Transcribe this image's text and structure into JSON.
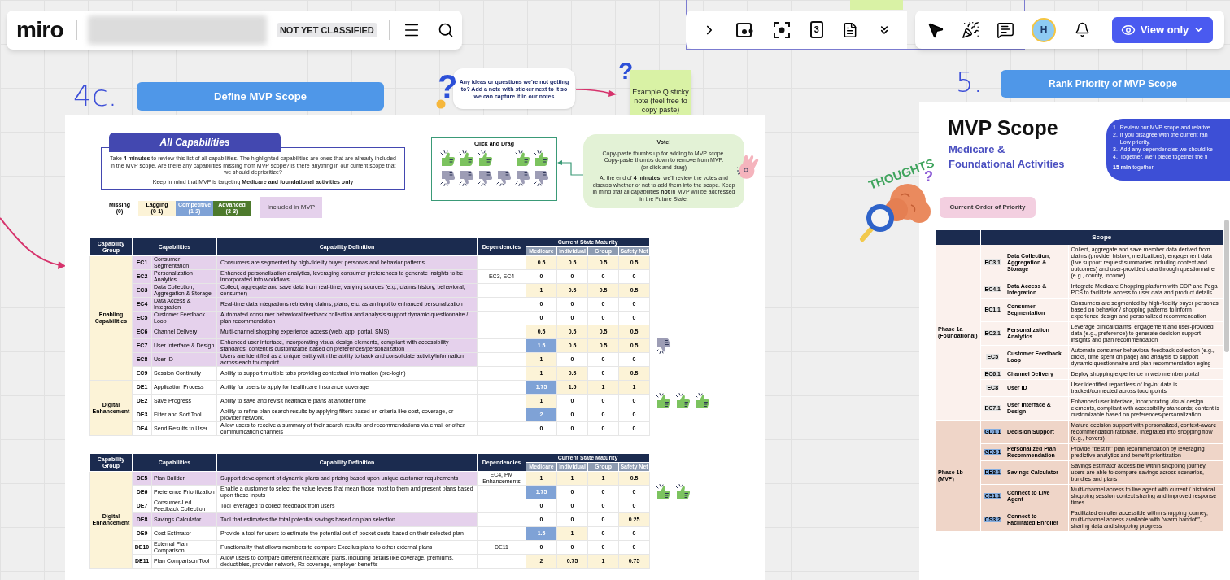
{
  "top_bar": {
    "logo": "miro",
    "classification": "NOT YET CLASSIFIED"
  },
  "board_tools": {
    "timer_card": "3"
  },
  "collab_bar": {
    "avatar": "H",
    "view_button": "View only"
  },
  "section_4c": {
    "number": "4c.",
    "title": "Define MVP Scope"
  },
  "question_note": {
    "sticker": "?",
    "text": "Any ideas or questions we're not getting to? Add a note with sticker next to it so we can capture it in our notes"
  },
  "example_note": {
    "sticker": "?",
    "text": "Example Q sticky note (feel free to copy paste)"
  },
  "section_5": {
    "number": "5.",
    "title": "Rank Priority of MVP Scope"
  },
  "thoughts_sticker": {
    "word": "THOUGHTS",
    "mark": "?"
  },
  "capabilities_frame": {
    "heading": "All Capabilities",
    "intro": "Take **4 minutes** to review this list of all capabilities. The highlighted capabilities are ones that are already included in the MVP scope. Are there any capabilities missing from MVP scope? Is there anything in our current scope that we should deprioritize?",
    "note": "Keep in mind that MVP is targeting **Medicare and foundational activities only**",
    "legend": [
      {
        "label": "Missing",
        "range": "(0)",
        "kind": "missing"
      },
      {
        "label": "Lagging",
        "range": "(0-1)",
        "kind": "lagging"
      },
      {
        "label": "Competitive",
        "range": "(1-2)",
        "kind": "competitive"
      },
      {
        "label": "Advanced",
        "range": "(2-3)",
        "kind": "advanced"
      }
    ],
    "mvp_legend": "Included in MVP",
    "drag_box": {
      "title": "Click and Drag",
      "stickers": [
        {
          "kind": "up"
        },
        {
          "kind": "up"
        },
        {
          "kind": "up"
        },
        {
          "kind": "blank"
        },
        {
          "kind": "up"
        },
        {
          "kind": "up"
        },
        {
          "kind": "down"
        },
        {
          "kind": "down"
        },
        {
          "kind": "down"
        },
        {
          "kind": "down"
        },
        {
          "kind": "down"
        },
        {
          "kind": "down"
        }
      ]
    },
    "vote_box": {
      "title": "Vote!",
      "instructions": "Copy-paste thumbs up for adding to MVP scope. Copy-paste thumbs down to remove from MVP.",
      "hint": "(or click and drag)",
      "body": "At the end of **4 minutes**, we'll review the votes and discuss whether or not to add them into the scope. Keep in mind that all capabilities **not** in MVP will be addressed in the Future State."
    },
    "tables": [
      {
        "columns": {
          "group": "Capability Group",
          "capabilities": "Capabilities",
          "definition": "Capability Definition",
          "dependencies": "Dependencies",
          "maturity_title": "Current State Maturity",
          "maturity": [
            "Medicare",
            "Individual",
            "Group",
            "Safety Net"
          ]
        },
        "groups": [
          {
            "name": "Enabling Capabilities",
            "rows": [
              {
                "code": "EC1",
                "name": "Consumer Segmentation",
                "definition": "Consumers are segmented by high-fidelity buyer personas and behavior patterns",
                "included": true,
                "maturity": [
                  {
                    "value": "0.5",
                    "kind": "lagging"
                  },
                  {
                    "value": "0.5",
                    "kind": "lagging"
                  },
                  {
                    "value": "0.5",
                    "kind": "lagging"
                  },
                  {
                    "value": "0.5",
                    "kind": "lagging"
                  }
                ]
              },
              {
                "code": "EC2",
                "name": "Personalization Analytics",
                "definition": "Enhanced personalization analytics, leveraging consumer preferences to generate insights to be incorporated into workflows",
                "dependencies": "EC3, EC4",
                "included": true,
                "maturity": [
                  {
                    "value": "0",
                    "kind": "missing"
                  },
                  {
                    "value": "0",
                    "kind": "missing"
                  },
                  {
                    "value": "0",
                    "kind": "missing"
                  },
                  {
                    "value": "0",
                    "kind": "missing"
                  }
                ]
              },
              {
                "code": "EC3",
                "name": "Data Collection, Aggregation & Storage",
                "definition": "Collect, aggregate and save data from real-time, varying sources (e.g., claims history, behavioral, consumer)",
                "included": true,
                "maturity": [
                  {
                    "value": "1",
                    "kind": "lagging"
                  },
                  {
                    "value": "0.5",
                    "kind": "lagging"
                  },
                  {
                    "value": "0.5",
                    "kind": "lagging"
                  },
                  {
                    "value": "0.5",
                    "kind": "lagging"
                  }
                ]
              },
              {
                "code": "EC4",
                "name": "Data Access & Integration",
                "definition": "Real-time data integrations retrieving claims, plans, etc. as an input to enhanced personalization",
                "included": true,
                "maturity": [
                  {
                    "value": "0",
                    "kind": "missing"
                  },
                  {
                    "value": "0",
                    "kind": "missing"
                  },
                  {
                    "value": "0",
                    "kind": "missing"
                  },
                  {
                    "value": "0",
                    "kind": "missing"
                  }
                ]
              },
              {
                "code": "EC5",
                "name": "Customer Feedback Loop",
                "definition": "Automated consumer behavioral feedback collection and analysis support dynamic questionnaire / plan recommendation",
                "included": true,
                "maturity": [
                  {
                    "value": "0",
                    "kind": "missing"
                  },
                  {
                    "value": "0",
                    "kind": "missing"
                  },
                  {
                    "value": "0",
                    "kind": "missing"
                  },
                  {
                    "value": "0",
                    "kind": "missing"
                  }
                ]
              },
              {
                "code": "EC6",
                "name": "Channel Delivery",
                "definition": "Multi-channel shopping experience access (web, app, portal, SMS)",
                "included": true,
                "maturity": [
                  {
                    "value": "0.5",
                    "kind": "lagging"
                  },
                  {
                    "value": "0.5",
                    "kind": "lagging"
                  },
                  {
                    "value": "0.5",
                    "kind": "lagging"
                  },
                  {
                    "value": "0.5",
                    "kind": "lagging"
                  }
                ]
              },
              {
                "code": "EC7",
                "name": "User Interface & Design",
                "definition": "Enhanced user interface, incorporating visual design elements, compliant with accessibility standards; content is customizable based on preferences/personalization",
                "included": true,
                "maturity": [
                  {
                    "value": "1.5",
                    "kind": "competitive"
                  },
                  {
                    "value": "0.5",
                    "kind": "lagging"
                  },
                  {
                    "value": "0.5",
                    "kind": "lagging"
                  },
                  {
                    "value": "0.5",
                    "kind": "lagging"
                  }
                ],
                "votes": [
                  {
                    "kind": "down"
                  }
                ]
              },
              {
                "code": "EC8",
                "name": "User ID",
                "definition": "Users are identified as a unique entity with the ability to track and consolidate activity/information across each touchpoint",
                "included": true,
                "maturity": [
                  {
                    "value": "1",
                    "kind": "lagging"
                  },
                  {
                    "value": "0",
                    "kind": "missing"
                  },
                  {
                    "value": "0",
                    "kind": "missing"
                  },
                  {
                    "value": "0",
                    "kind": "missing"
                  }
                ]
              },
              {
                "code": "EC9",
                "name": "Session Continuity",
                "definition": "Ability to support multiple tabs providing contextual information (pre-login)",
                "included": false,
                "maturity": [
                  {
                    "value": "1",
                    "kind": "lagging"
                  },
                  {
                    "value": "0.5",
                    "kind": "lagging"
                  },
                  {
                    "value": "0",
                    "kind": "missing"
                  },
                  {
                    "value": "0.5",
                    "kind": "lagging"
                  }
                ]
              }
            ]
          },
          {
            "name": "Digital Enhancement",
            "rows": [
              {
                "code": "DE1",
                "name": "Application Process",
                "definition": "Ability for users to apply for healthcare insurance coverage",
                "included": false,
                "maturity": [
                  {
                    "value": "1.75",
                    "kind": "competitive"
                  },
                  {
                    "value": "1.5",
                    "kind": "lagging"
                  },
                  {
                    "value": "1",
                    "kind": "lagging"
                  },
                  {
                    "value": "1",
                    "kind": "lagging"
                  }
                ]
              },
              {
                "code": "DE2",
                "name": "Save Progress",
                "definition": "Ability to save and revisit healthcare plans at another time",
                "included": false,
                "maturity": [
                  {
                    "value": "1",
                    "kind": "lagging"
                  },
                  {
                    "value": "0",
                    "kind": "missing"
                  },
                  {
                    "value": "0",
                    "kind": "missing"
                  },
                  {
                    "value": "0",
                    "kind": "missing"
                  }
                ],
                "votes": [
                  {
                    "kind": "up"
                  },
                  {
                    "kind": "up"
                  },
                  {
                    "kind": "up"
                  }
                ]
              },
              {
                "code": "DE3",
                "name": "Filter and Sort Tool",
                "definition": "Ability to refine plan search results by applying filters based on criteria like cost, coverage, or provider network.",
                "included": false,
                "maturity": [
                  {
                    "value": "2",
                    "kind": "competitive"
                  },
                  {
                    "value": "0",
                    "kind": "missing"
                  },
                  {
                    "value": "0",
                    "kind": "missing"
                  },
                  {
                    "value": "0",
                    "kind": "missing"
                  }
                ]
              },
              {
                "code": "DE4",
                "name": "Send Results to User",
                "definition": "Allow users to receive a summary of their search results and recommendations via email or other communication channels",
                "included": false,
                "maturity": [
                  {
                    "value": "0",
                    "kind": "missing"
                  },
                  {
                    "value": "0",
                    "kind": "missing"
                  },
                  {
                    "value": "0",
                    "kind": "missing"
                  },
                  {
                    "value": "0",
                    "kind": "missing"
                  }
                ]
              }
            ]
          }
        ]
      },
      {
        "columns": {
          "group": "Capability Group",
          "capabilities": "Capabilities",
          "definition": "Capability Definition",
          "dependencies": "Dependencies",
          "maturity_title": "Current State Maturity",
          "maturity": [
            "Medicare",
            "Individual",
            "Group",
            "Safety Net"
          ]
        },
        "groups": [
          {
            "name": "Digital Enhancement",
            "rows": [
              {
                "code": "DE5",
                "name": "Plan Builder",
                "definition": "Support development of dynamic plans and pricing based upon unique customer requirements",
                "dependencies": "EC4, PM Enhancements",
                "included": true,
                "maturity": [
                  {
                    "value": "1",
                    "kind": "lagging"
                  },
                  {
                    "value": "1",
                    "kind": "lagging"
                  },
                  {
                    "value": "1",
                    "kind": "lagging"
                  },
                  {
                    "value": "0.5",
                    "kind": "lagging"
                  }
                ]
              },
              {
                "code": "DE6",
                "name": "Preference Prioritization",
                "definition": "Enable a customer to select the value levers that mean those most to them and present plans based upon those inputs",
                "included": false,
                "maturity": [
                  {
                    "value": "1.75",
                    "kind": "competitive"
                  },
                  {
                    "value": "0",
                    "kind": "missing"
                  },
                  {
                    "value": "0",
                    "kind": "missing"
                  },
                  {
                    "value": "0",
                    "kind": "missing"
                  }
                ],
                "votes": [
                  {
                    "kind": "up"
                  },
                  {
                    "kind": "up"
                  }
                ]
              },
              {
                "code": "DE7",
                "name": "Consumer-Led Feedback Collection",
                "definition": "Tool leveraged to collect feedback from users",
                "included": false,
                "maturity": [
                  {
                    "value": "0",
                    "kind": "missing"
                  },
                  {
                    "value": "0",
                    "kind": "missing"
                  },
                  {
                    "value": "0",
                    "kind": "missing"
                  },
                  {
                    "value": "0",
                    "kind": "missing"
                  }
                ]
              },
              {
                "code": "DE8",
                "name": "Savings Calculator",
                "definition": "Tool that estimates the total potential savings based on plan selection",
                "included": true,
                "maturity": [
                  {
                    "value": "0",
                    "kind": "missing"
                  },
                  {
                    "value": "0",
                    "kind": "missing"
                  },
                  {
                    "value": "0",
                    "kind": "missing"
                  },
                  {
                    "value": "0.25",
                    "kind": "lagging"
                  }
                ]
              },
              {
                "code": "DE9",
                "name": "Cost Estimator",
                "definition": "Provide a tool for users to estimate the potential out-of-pocket costs based on their selected plan",
                "included": false,
                "maturity": [
                  {
                    "value": "1.5",
                    "kind": "competitive"
                  },
                  {
                    "value": "1",
                    "kind": "lagging"
                  },
                  {
                    "value": "0",
                    "kind": "missing"
                  },
                  {
                    "value": "0",
                    "kind": "missing"
                  }
                ]
              },
              {
                "code": "DE10",
                "name": "External Plan Comparison",
                "definition": "Functionality that allows members to compare Excellus plans to other external plans",
                "dependencies": "DE11",
                "included": false,
                "maturity": [
                  {
                    "value": "0",
                    "kind": "missing"
                  },
                  {
                    "value": "0",
                    "kind": "missing"
                  },
                  {
                    "value": "0",
                    "kind": "missing"
                  },
                  {
                    "value": "0",
                    "kind": "missing"
                  }
                ]
              },
              {
                "code": "DE11",
                "name": "Plan Comparison Tool",
                "definition": "Allow users to compare different healthcare plans, including details like coverage, premiums, deductibles, provider network, Rx coverage, employer benefits",
                "included": false,
                "maturity": [
                  {
                    "value": "2",
                    "kind": "lagging"
                  },
                  {
                    "value": "0.75",
                    "kind": "lagging"
                  },
                  {
                    "value": "1",
                    "kind": "lagging"
                  },
                  {
                    "value": "0.75",
                    "kind": "lagging"
                  }
                ]
              }
            ]
          }
        ]
      }
    ]
  },
  "priority_frame": {
    "title": "MVP Scope",
    "subtitle": [
      "Medicare &",
      "Foundational Activities"
    ],
    "instructions": [
      {
        "number": "1.",
        "lines": [
          "Review our MVP scope and relative"
        ]
      },
      {
        "number": "2.",
        "lines": [
          "If you disagree with the current ran",
          "Low priority."
        ]
      },
      {
        "number": "3.",
        "lines": [
          "Add any dependencies we should ke"
        ]
      },
      {
        "number": "4.",
        "lines": [
          "Together, we'll piece together the fi"
        ]
      }
    ],
    "duration": "**15 min** together",
    "badge": "Current Order of Priority",
    "table": {
      "header": "Scope",
      "phases": [
        {
          "name": "Phase 1a (Foundational)",
          "kind": "foundational",
          "rows": [
            {
              "code": "EC3.1",
              "name": "Data Collection, Aggregation & Storage",
              "description": "Collect, aggregate and save member data derived from claims (provider history, medications), engagement data (live support request summaries including context and outcomes) and user-provided data through questionnaire (e.g., county, income)"
            },
            {
              "code": "EC4.1",
              "name": "Data Access & Integration",
              "description": "Integrate Medicare Shopping platform with CDP and Pega PCS to facilitate access to user data and product details"
            },
            {
              "code": "EC1.1",
              "name": "Consumer Segmentation",
              "description": "Consumers are segmented by high-fidelity buyer personas based on behavior / shopping patterns to inform experience design and personalized recommendation"
            },
            {
              "code": "EC2.1",
              "name": "Personalization Analytics",
              "description": "Leverage clinical/claims, engagement and user-provided data (e.g., preference) to generate decision support insights and plan recommendation"
            },
            {
              "code": "EC5",
              "name": "Customer Feedback Loop",
              "description": "Automate consumer behavioral feedback collection (e.g., clicks, time spent on page) and analysis to support dynamic questionnaire and plan recommendation eging"
            },
            {
              "code": "EC6.1",
              "name": "Channel Delivery",
              "description": "Deploy shopping experience in web member portal"
            },
            {
              "code": "EC8",
              "name": "User ID",
              "description": "User identified regardless of log-in; data is tracked/connected across touchpoints"
            },
            {
              "code": "EC7.1",
              "name": "User Interface & Design",
              "description": "Enhanced user interface, incorporating visual design elements, compliant with accessibility standards; content is customizable based on preferences/personalization"
            }
          ]
        },
        {
          "name": "Phase 1b (MVP)",
          "kind": "mvp",
          "rows": [
            {
              "code": "GD1.1",
              "name": "Decision Support",
              "description": "Mature decision support with personalized, context-aware recommendation rationale, integrated into shopping flow (e.g., hovers)"
            },
            {
              "code": "GD3.1",
              "name": "Personalized Plan Recommendation",
              "description": "Provide \"best fit\" plan recommendation by leveraging predictive analytics and benefit prioritization"
            },
            {
              "code": "DE8.1",
              "name": "Savings Calculator",
              "description": "Savings estimator accessible within shopping journey, users are able to compare savings across scenarios, bundles and plans"
            },
            {
              "code": "CS1.1",
              "name": "Connect to Live Agent",
              "description": "Multi-channel access to live agent with current / historical shopping session context sharing and improved response times"
            },
            {
              "code": "CS3.2",
              "name": "Connect to Facilitated Enroller",
              "description": "Facilitated enroller accessible within shopping journey, multi-channel access available with \"warm handoff\", sharing data and shopping progress"
            }
          ]
        }
      ]
    }
  }
}
